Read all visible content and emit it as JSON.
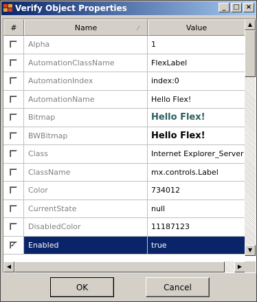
{
  "window": {
    "title": "Verify Object Properties",
    "minimize": "_",
    "maximize": "□",
    "close": "×"
  },
  "grid": {
    "headers": {
      "check": "#",
      "name": "Name",
      "value": "Value"
    },
    "rows": [
      {
        "checked": false,
        "name": "Alpha",
        "value": "1"
      },
      {
        "checked": false,
        "name": "AutomationClassName",
        "value": "FlexLabel"
      },
      {
        "checked": false,
        "name": "AutomationIndex",
        "value": "index:0"
      },
      {
        "checked": false,
        "name": "AutomationName",
        "value": "Hello Flex!"
      },
      {
        "checked": false,
        "name": "Bitmap",
        "value": "Hello Flex!"
      },
      {
        "checked": false,
        "name": "BWBitmap",
        "value": "Hello Flex!"
      },
      {
        "checked": false,
        "name": "Class",
        "value": "Internet Explorer_Server"
      },
      {
        "checked": false,
        "name": "ClassName",
        "value": "mx.controls.Label"
      },
      {
        "checked": false,
        "name": "Color",
        "value": "734012"
      },
      {
        "checked": false,
        "name": "CurrentState",
        "value": "null"
      },
      {
        "checked": false,
        "name": "DisabledColor",
        "value": "11187123"
      },
      {
        "checked": true,
        "name": "Enabled",
        "value": "true"
      }
    ],
    "selected_row": 11
  },
  "buttons": {
    "ok": "OK",
    "cancel": "Cancel"
  },
  "colors": {
    "title_start": "#0a246a",
    "title_end": "#a6caf0",
    "selection": "#0a246a",
    "bitmap_text": "#2a5f5f"
  }
}
